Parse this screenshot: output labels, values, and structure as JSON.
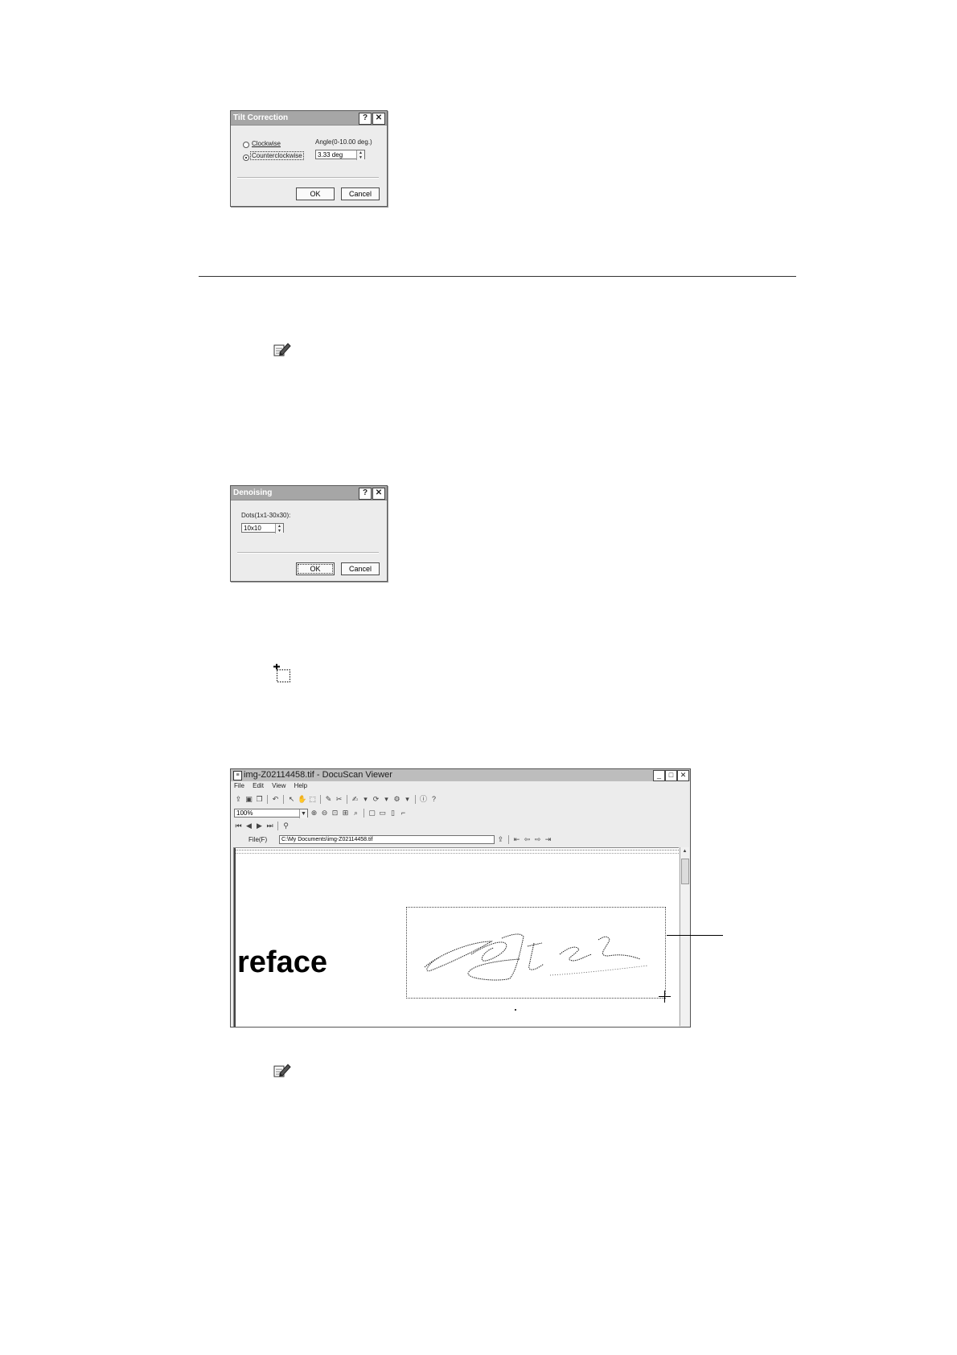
{
  "tilt_dialog": {
    "title": "Tilt Correction",
    "help_btn": "?",
    "close_btn": "✕",
    "radio_clockwise": "Clockwise",
    "radio_counterclockwise": "Counterclockwise",
    "selected": "Counterclockwise",
    "angle_label": "Angle(0-10.00 deg.)",
    "angle_value": "3.33 deg",
    "ok": "OK",
    "cancel": "Cancel"
  },
  "denoise_dialog": {
    "title": "Denoising",
    "help_btn": "?",
    "close_btn": "✕",
    "dots_label": "Dots(1x1-30x30):",
    "dots_value": "10x10",
    "ok": "OK",
    "cancel": "Cancel"
  },
  "icons": {
    "note_icon_1": "note-icon",
    "select_area_icon": "select-area-icon",
    "note_icon_2": "note-icon"
  },
  "viewer": {
    "title": "img-Z02114458.tif - DocuScan Viewer",
    "menu": [
      "File",
      "Edit",
      "View",
      "Help"
    ],
    "zoom": "100%",
    "file_label": "File(F)",
    "file_path": "C:\\My Documents\\img-Z02114458.tif",
    "page_text": "reface"
  }
}
